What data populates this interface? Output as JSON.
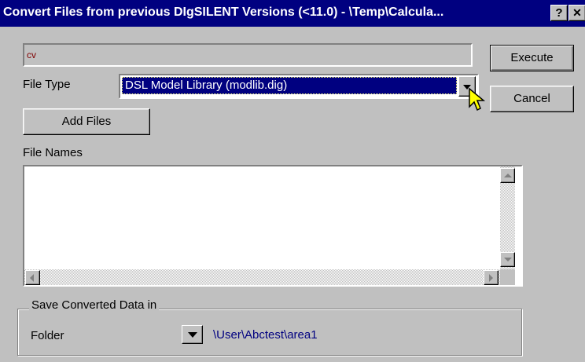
{
  "window": {
    "title": "Convert Files from previous DIgSILENT Versions (<11.0) - \\Temp\\Calcula...",
    "help_label": "?",
    "close_label": "✕"
  },
  "path_field": {
    "value": "cv"
  },
  "buttons": {
    "execute": "Execute",
    "cancel": "Cancel",
    "add_files": "Add Files"
  },
  "file_type": {
    "label": "File Type",
    "selected": "DSL Model Library (modlib.dig)"
  },
  "file_names": {
    "label": "File Names",
    "items": []
  },
  "save_group": {
    "legend": "Save Converted Data in",
    "folder_label": "Folder",
    "folder_path": "\\User\\Abctest\\area1"
  },
  "colors": {
    "titlebar": "#000080",
    "selection": "#000080",
    "path_text": "#800000",
    "folder_text": "#000080"
  },
  "icons": [
    "help-icon",
    "close-icon",
    "dropdown-arrow-icon",
    "scroll-up-icon",
    "scroll-down-icon",
    "scroll-left-icon",
    "scroll-right-icon",
    "mouse-cursor-icon"
  ]
}
